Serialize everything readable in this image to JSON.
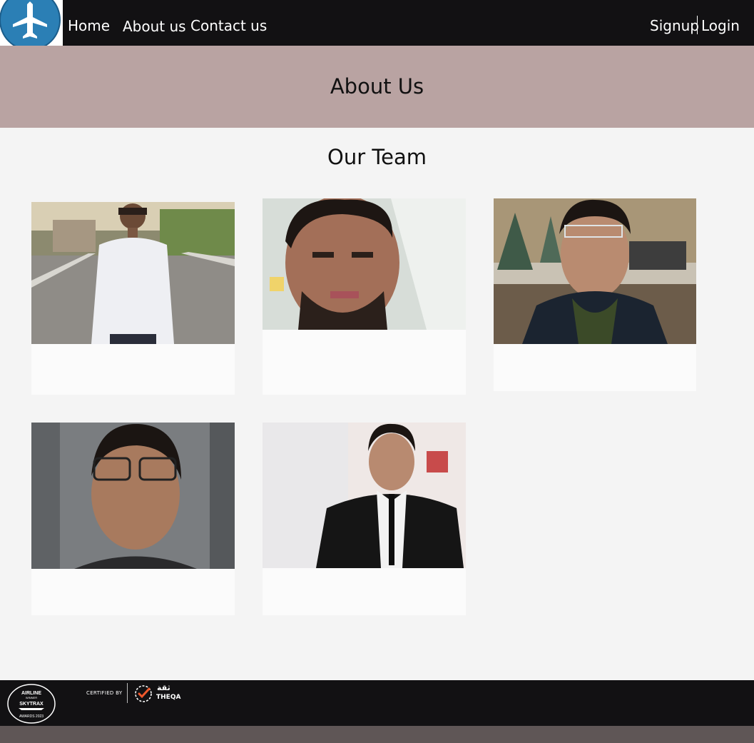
{
  "nav": {
    "links": [
      {
        "label": "Home"
      },
      {
        "label": "About us"
      },
      {
        "label": "Contact us"
      }
    ],
    "signup_label": "Signup",
    "login_label": "Login",
    "logo_icon": "airplane-icon"
  },
  "hero": {
    "title": "About Us"
  },
  "team": {
    "heading": "Our Team",
    "members": [
      {
        "photo": "team-member-photo-1"
      },
      {
        "photo": "team-member-photo-2"
      },
      {
        "photo": "team-member-photo-3"
      },
      {
        "photo": "team-member-photo-4"
      },
      {
        "photo": "team-member-photo-5"
      }
    ]
  },
  "footer": {
    "badge": {
      "line1": "AIRLINE",
      "line2": "WINNER",
      "line3": "SKYTRAX",
      "line4": "AWARDS 2023"
    },
    "certified_label": "CERTIFIED BY",
    "cert_name": "THEQA",
    "cert_arabic": "ثقة"
  },
  "colors": {
    "navbar": "#121113",
    "hero": "#b9a3a2",
    "page": "#f4f4f4",
    "card": "#fbfbfb",
    "bottom_strip": "#5f5656"
  }
}
